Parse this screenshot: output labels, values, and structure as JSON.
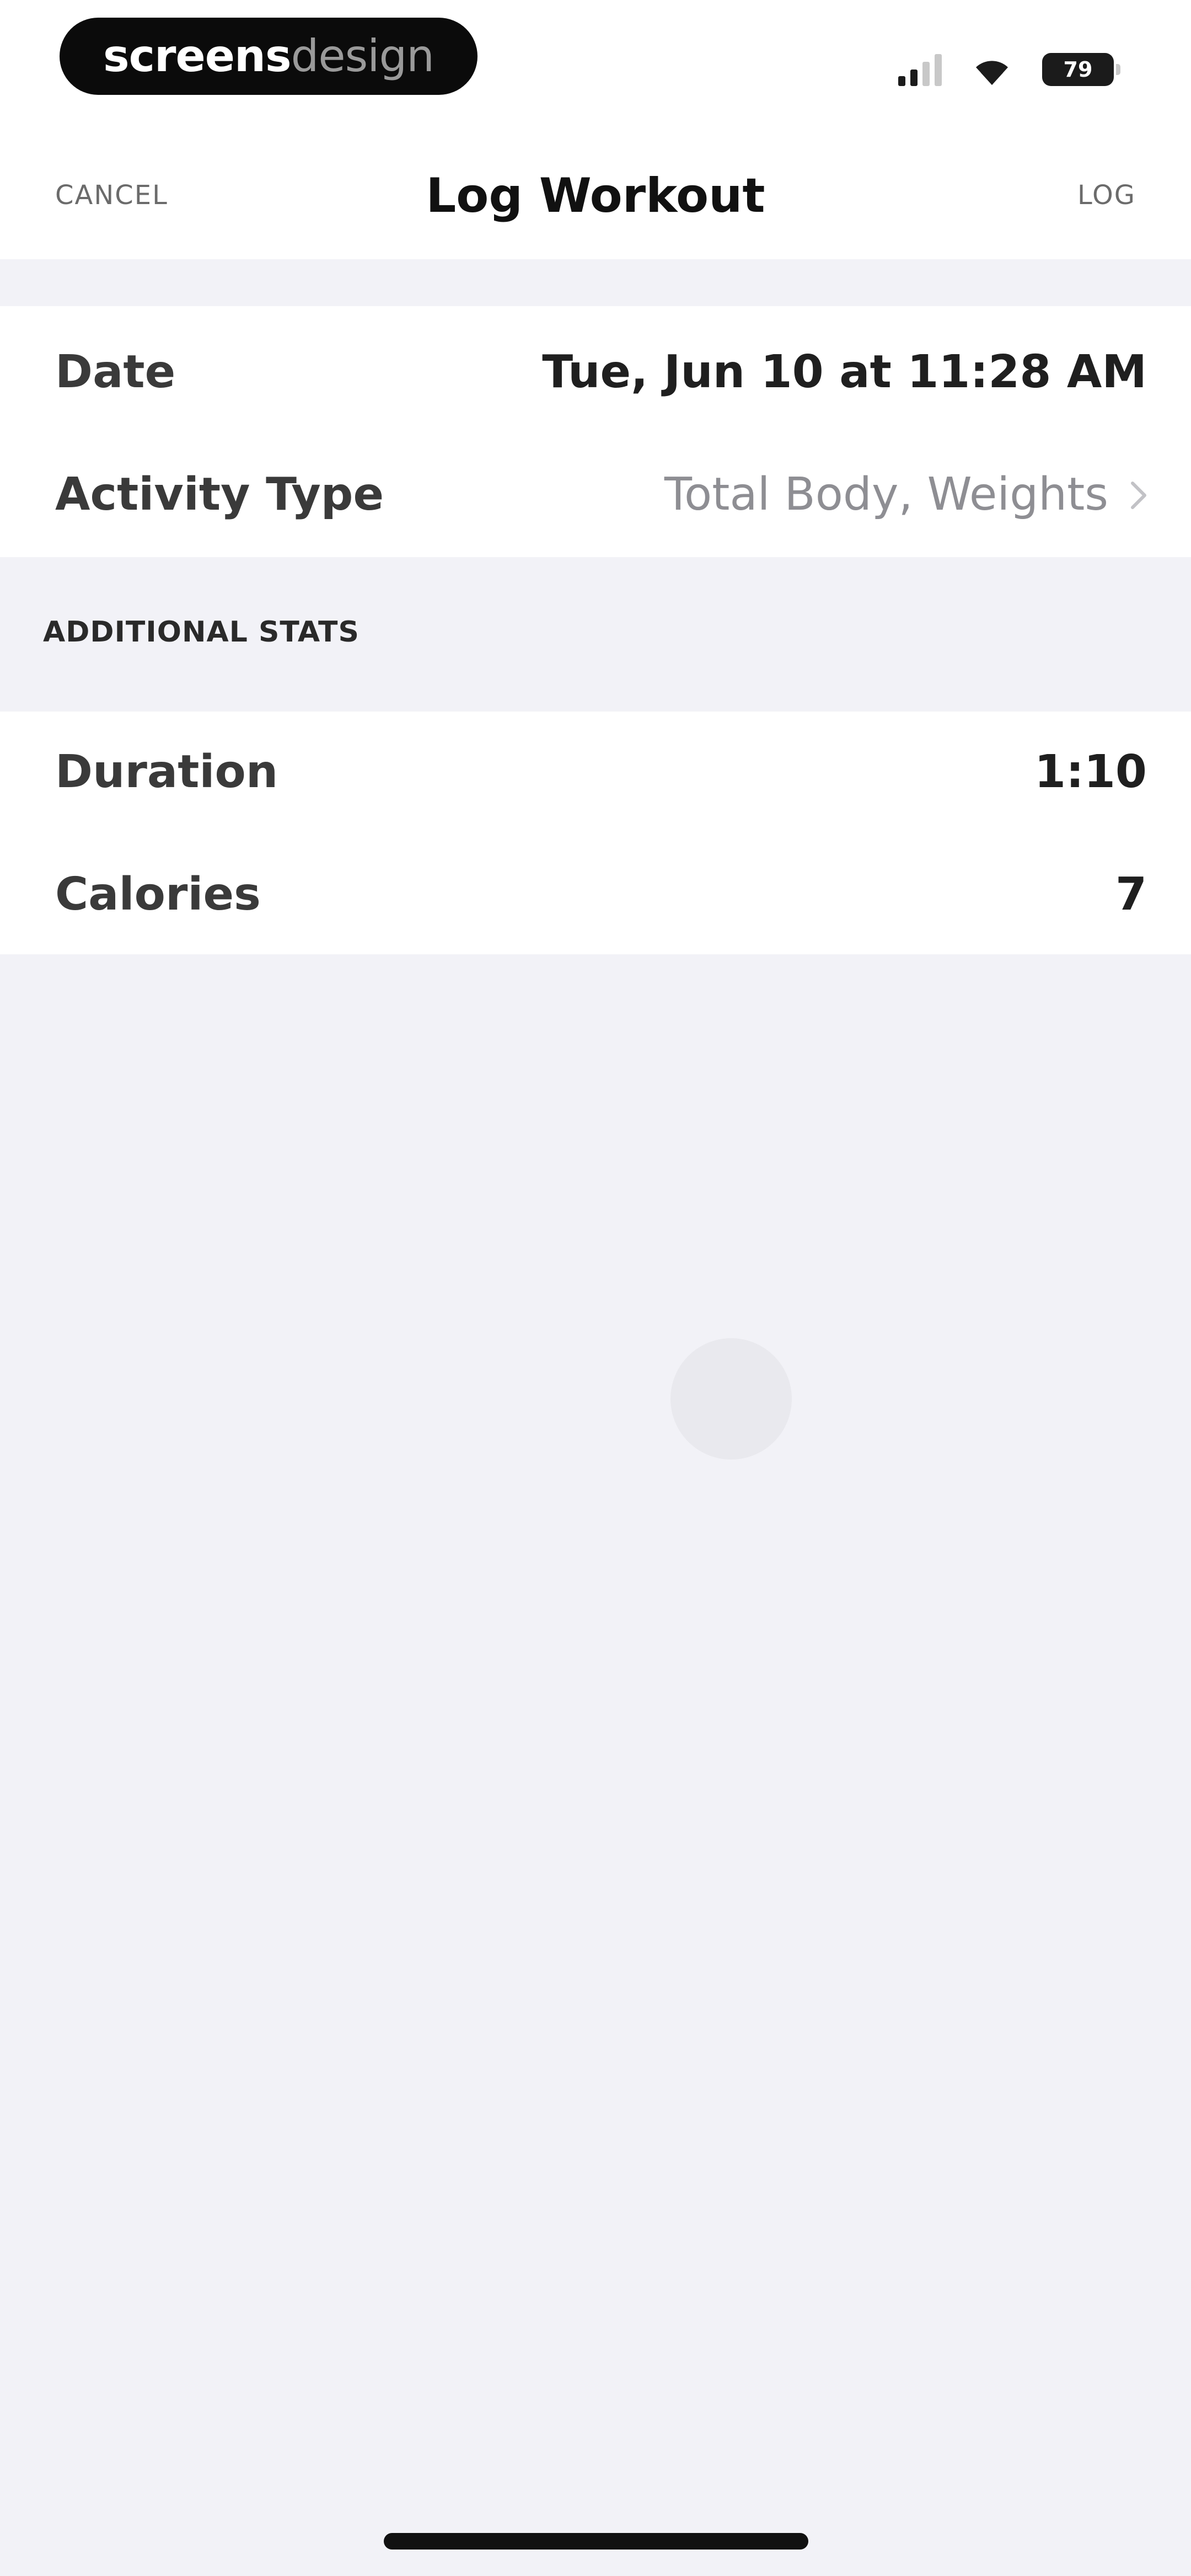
{
  "status_bar": {
    "brand_primary": "screens",
    "brand_secondary": "design",
    "battery_level": "79"
  },
  "nav": {
    "cancel_label": "CANCEL",
    "title": "Log Workout",
    "log_label": "LOG"
  },
  "details": {
    "date_label": "Date",
    "date_value": "Tue, Jun 10 at 11:28 AM",
    "activity_label": "Activity Type",
    "activity_value": "Total Body, Weights"
  },
  "additional_stats": {
    "header": "ADDITIONAL STATS",
    "duration_label": "Duration",
    "duration_value": "1:10",
    "calories_label": "Calories",
    "calories_value": "7"
  },
  "icons": {
    "signal": "cellular-signal-icon",
    "wifi": "wifi-icon",
    "battery": "battery-icon",
    "chevron": "chevron-right-icon",
    "spinner": "loading-spinner-icon"
  },
  "colors": {
    "background": "#f2f2f7",
    "card": "#ffffff",
    "text_primary": "#1f1f1f",
    "text_muted": "#8e8e93"
  }
}
